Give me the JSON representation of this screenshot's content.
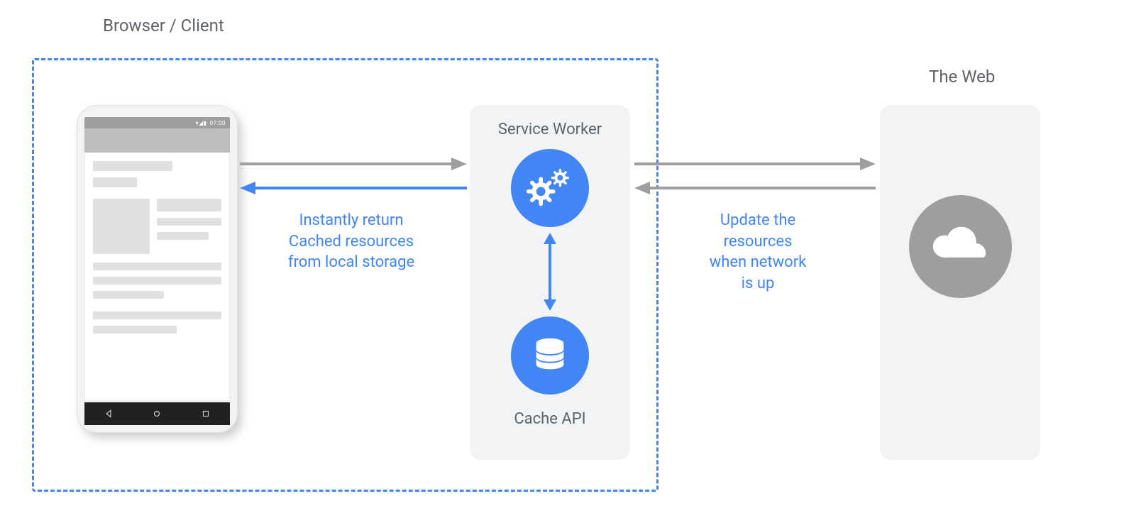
{
  "labels": {
    "browser_client": "Browser / Client",
    "the_web": "The Web",
    "service_worker": "Service Worker",
    "cache_api": "Cache API"
  },
  "arrows": {
    "client_to_sw_caption_l1": "Instantly return",
    "client_to_sw_caption_l2": "Cached resources",
    "client_to_sw_caption_l3": "from local storage",
    "sw_to_web_caption_l1": "Update the",
    "sw_to_web_caption_l2": "resources",
    "sw_to_web_caption_l3": "when network",
    "sw_to_web_caption_l4": "is up"
  },
  "phone": {
    "status_time": "07:00"
  },
  "colors": {
    "blue": "#4285f4",
    "gray": "#9e9e9e",
    "darkText": "#5f6368",
    "panel": "#f1f3f4"
  },
  "icons": {
    "gears": "gears-icon",
    "database": "database-icon",
    "cloud": "cloud-icon"
  }
}
